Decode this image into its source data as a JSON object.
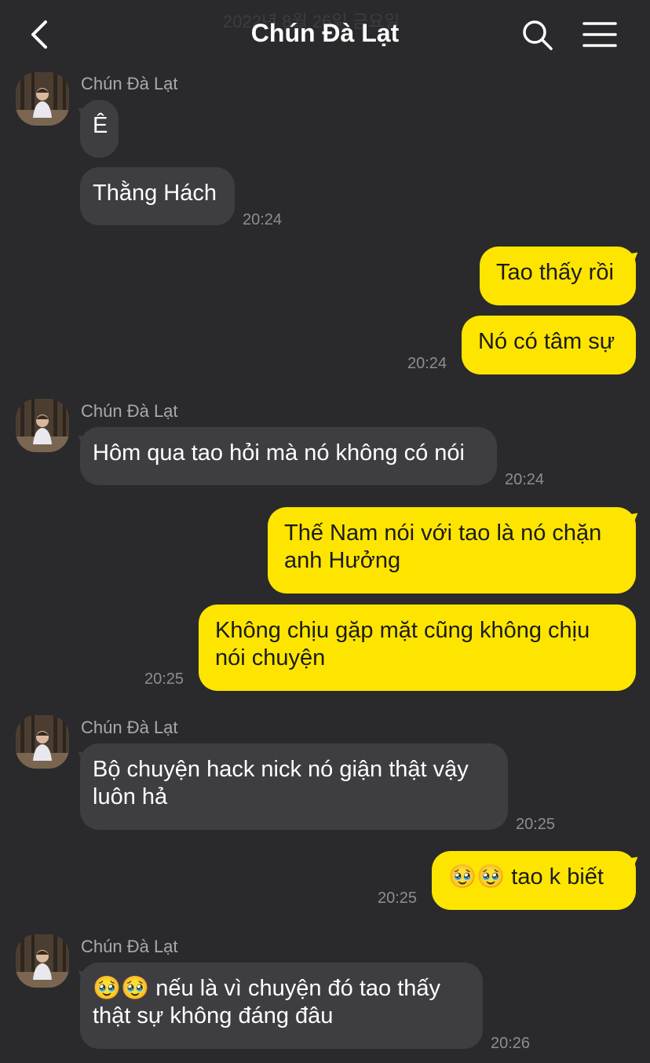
{
  "header": {
    "date_ghost": "2022년 8월 26일 금요일",
    "title": "Chún Đà Lạt",
    "back_icon": "chevron-left-icon",
    "search_icon": "search-icon",
    "menu_icon": "menu-icon"
  },
  "colors": {
    "background": "#2a2a2d",
    "incoming_bubble": "#3e3e42",
    "outgoing_bubble": "#fee500"
  },
  "messages": {
    "m1": {
      "sender": "Chún Đà Lạt",
      "text": "Ê"
    },
    "m2": {
      "text": "Thằng Hách",
      "time": "20:24"
    },
    "m3": {
      "text": "Tao thấy rồi"
    },
    "m4": {
      "text": "Nó có tâm sự",
      "time": "20:24"
    },
    "m5": {
      "sender": "Chún Đà Lạt",
      "text": "Hôm qua tao hỏi mà nó không có nói",
      "time": "20:24"
    },
    "m6": {
      "line1": "Thế Nam nói với tao là nó chặn",
      "line2": "anh Hưởng"
    },
    "m7": {
      "line1": "Không chịu gặp mặt cũng không chịu",
      "line2": "nói chuyện",
      "time": "20:25"
    },
    "m8": {
      "sender": "Chún Đà Lạt",
      "line1": "Bộ chuyện hack nick nó giận thật vậy",
      "line2": "luôn hả",
      "time": "20:25"
    },
    "m9": {
      "emoji": "🥹🥹",
      "text": "tao k biết",
      "time": "20:25"
    },
    "m10": {
      "sender": "Chún Đà Lạt",
      "emoji": "🥹🥹",
      "line1": "nếu là vì chuyện đó tao thấy",
      "line2": "thật sự không đáng đâu",
      "time": "20:26"
    }
  }
}
